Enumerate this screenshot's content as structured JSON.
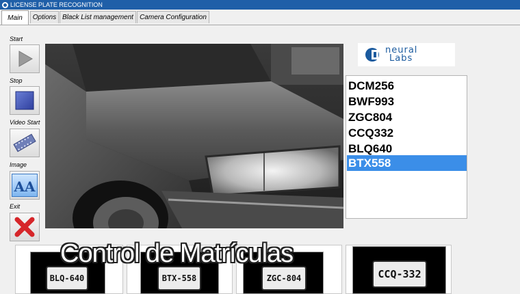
{
  "window": {
    "title": "LICENSE PLATE RECOGNITION"
  },
  "tabs": [
    {
      "label": "Main",
      "active": true
    },
    {
      "label": "Options",
      "active": false
    },
    {
      "label": "Black List management",
      "active": false
    },
    {
      "label": "Camera Configuration",
      "active": false
    }
  ],
  "toolbar": {
    "start_label": "Start",
    "stop_label": "Stop",
    "video_start_label": "Video Start",
    "image_label": "Image",
    "exit_label": "Exit",
    "image_icon_text": "AA"
  },
  "logo": {
    "line1": "neural",
    "line2": "Labs"
  },
  "plates": [
    "DCM256",
    "BWF993",
    "ZGC804",
    "CCQ332",
    "BLQ640",
    "BTX558"
  ],
  "selected_plate_index": 5,
  "thumbnails": [
    {
      "plate_text": "BLQ-640"
    },
    {
      "plate_text": "BTX-558"
    },
    {
      "plate_text": "ZGC-804"
    },
    {
      "plate_text": "CCQ-332"
    }
  ],
  "overlay_caption": "Control de Matrículas",
  "colors": {
    "titlebar": "#1f5fa8",
    "selection": "#3b8ee8",
    "exit_icon": "#d6262a",
    "logo": "#1a5a9e"
  }
}
